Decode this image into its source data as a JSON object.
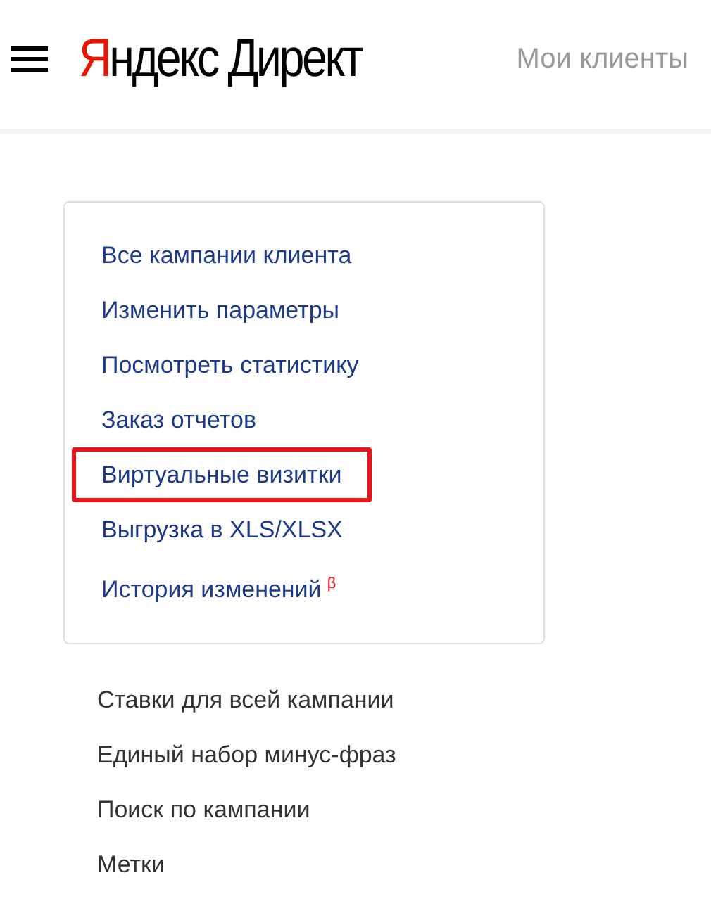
{
  "header": {
    "logo": {
      "accent": "Я",
      "rest": "ндекс",
      "product": "Директ"
    },
    "nav_link": "Мои клиенты"
  },
  "card": {
    "items": [
      {
        "label": "Все кампании клиента",
        "highlighted": false
      },
      {
        "label": "Изменить параметры",
        "highlighted": false
      },
      {
        "label": "Посмотреть статистику",
        "highlighted": false
      },
      {
        "label": "Заказ отчетов",
        "highlighted": false
      },
      {
        "label": "Виртуальные визитки",
        "highlighted": true
      },
      {
        "label": "Выгрузка в XLS/XLSX",
        "highlighted": false
      },
      {
        "label": "История изменений",
        "badge": "β",
        "highlighted": false
      }
    ]
  },
  "links": [
    "Ставки для всей кампании",
    "Единый набор минус-фраз",
    "Поиск по кампании",
    "Метки"
  ]
}
